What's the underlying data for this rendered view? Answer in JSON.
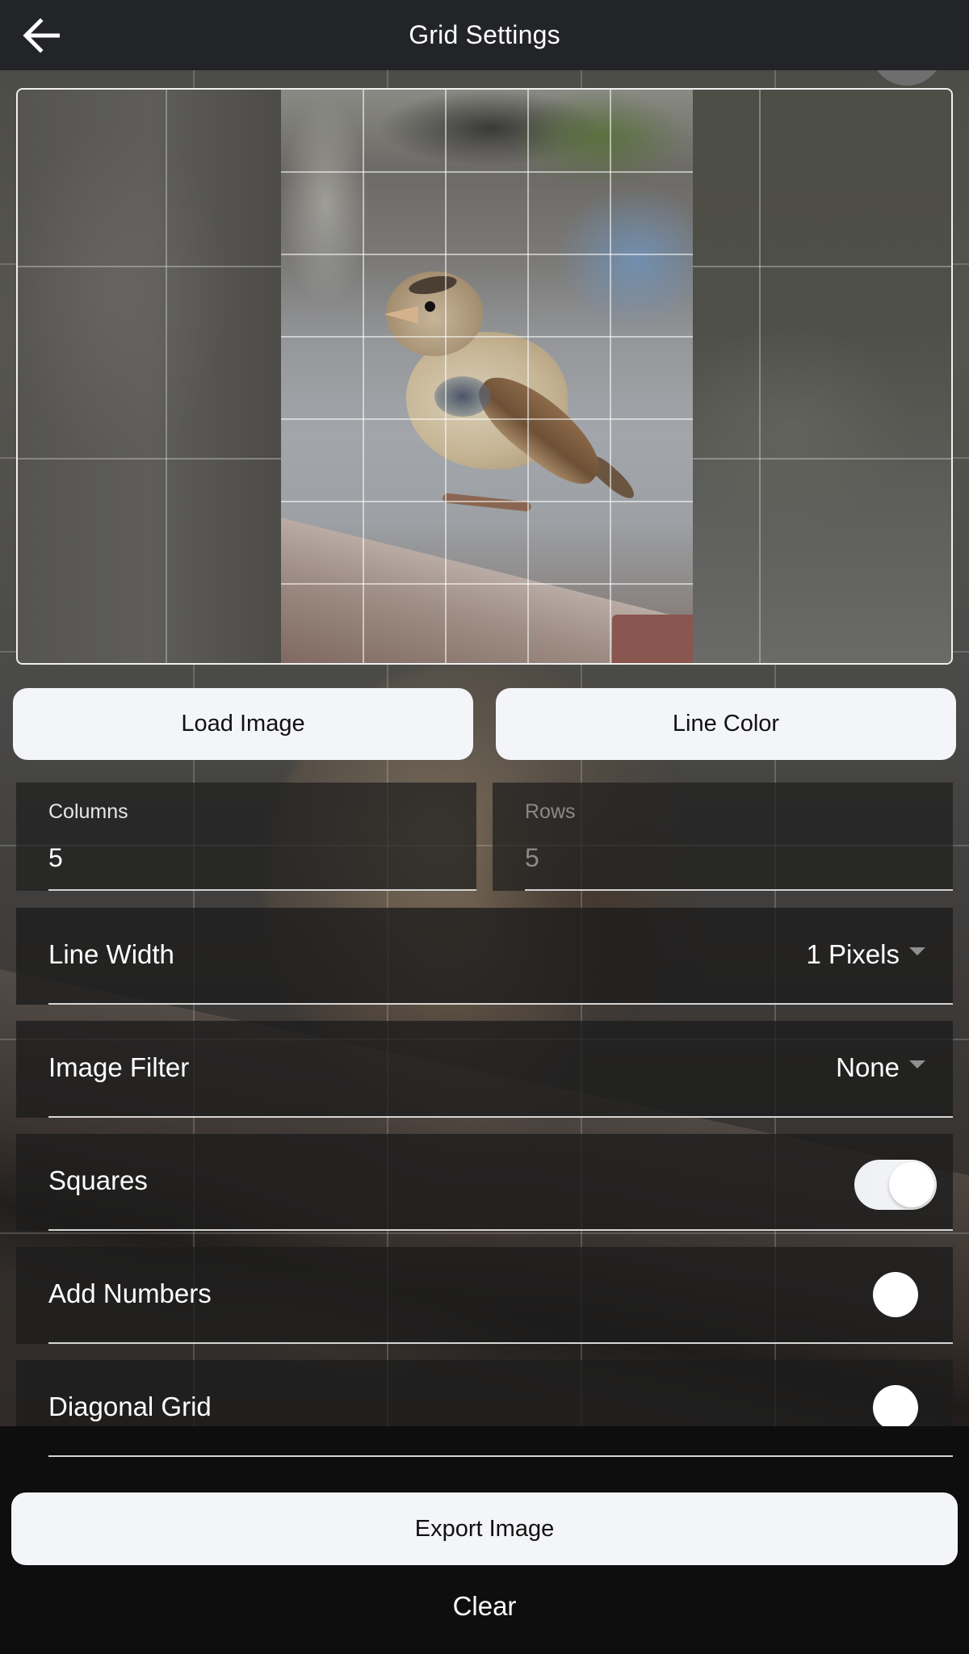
{
  "header": {
    "title": "Grid Settings",
    "back_icon": "arrow-left-icon"
  },
  "preview": {
    "image_subject": "sparrow perched on wooden bench",
    "grid_columns": 5,
    "grid_line_color": "#ffffff"
  },
  "actions": {
    "load_image_label": "Load Image",
    "line_color_label": "Line Color"
  },
  "fields": {
    "columns": {
      "label": "Columns",
      "value": "5"
    },
    "rows": {
      "label": "Rows",
      "value": "5",
      "disabled": true
    }
  },
  "settings": {
    "line_width": {
      "label": "Line Width",
      "value": "1 Pixels",
      "icon": "caret-down-icon"
    },
    "image_filter": {
      "label": "Image Filter",
      "value": "None",
      "icon": "caret-down-icon"
    },
    "squares": {
      "label": "Squares",
      "checked": true
    },
    "add_numbers": {
      "label": "Add Numbers",
      "checked": false
    },
    "diagonal_grid": {
      "label": "Diagonal Grid",
      "checked": false
    }
  },
  "footer": {
    "export_label": "Export Image",
    "clear_label": "Clear"
  },
  "colors": {
    "header_bg": "#232428",
    "button_bg": "#f4f5f9",
    "footer_bg": "#0e0e0e"
  }
}
